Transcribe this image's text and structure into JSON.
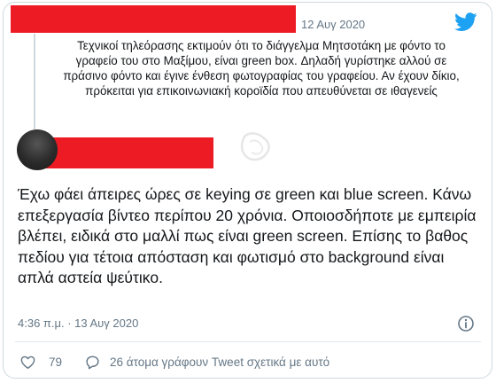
{
  "quoted_tweet": {
    "date": "12 Αυγ 2020",
    "text": "Τεχνικοί τηλεόρασης εκτιμούν ότι το διάγγελμα Μητσοτάκη με φόντο το γραφείο του στο Μαξίμου, είναι green box. Δηλαδή γυρίστηκε αλλού σε πράσινο φόντο και έγινε ένθεση φωτογραφίας του γραφείου. Αν έχουν δίκιο, πρόκειται για επικοινωνιακή κοροϊδία που απευθύνεται σε ιθαγενείς"
  },
  "main_tweet": {
    "text": "Έχω φάει άπειρες ώρες σε keying σε green και blue screen. Κάνω επεξεργασία βίντεο περίπου 20 χρόνια. Οποιοσδήποτε με εμπειρία βλέπει, ειδικά στο μαλλί πως είναι green screen. Επίσης το βαθος πεδίου για τέτοια απόσταση και φωτισμό στο background είναι απλά αστεία ψεύτικο.",
    "timestamp": "4:36 π.μ. · 13 Αυγ 2020"
  },
  "actions": {
    "like_count": "79",
    "reply_label": "26 άτομα γράφουν Tweet σχετικά με αυτό"
  },
  "icons": {
    "brand": "twitter-bird-icon",
    "like": "heart-icon",
    "reply": "speech-bubble-icon",
    "info": "info-icon"
  },
  "colors": {
    "twitter_blue": "#1da1f2",
    "redaction_red": "#ed1c24",
    "text": "#14171a",
    "muted": "#657786"
  }
}
